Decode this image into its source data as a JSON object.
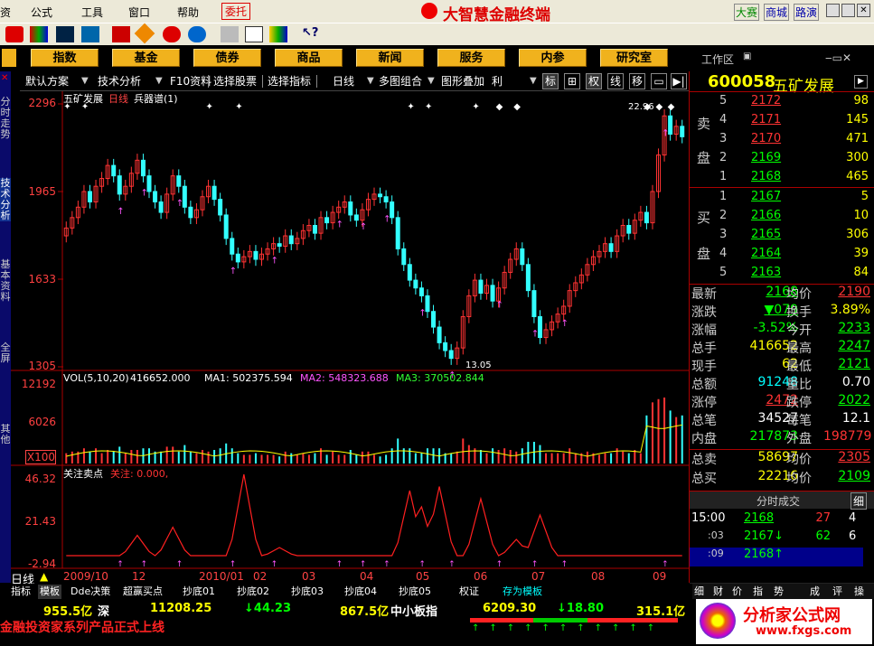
{
  "menu": {
    "items": [
      "资",
      "公式",
      "工具",
      "窗口",
      "帮助"
    ],
    "entrust": "委托",
    "app_title": "大智慧金融终端",
    "right_links": [
      "大赛",
      "商城",
      "路演"
    ]
  },
  "nav": {
    "buttons": [
      "指数",
      "基金",
      "债券",
      "商品",
      "新闻",
      "服务",
      "内参",
      "研究室"
    ],
    "workspace": "工作区"
  },
  "tabs": {
    "items": [
      "默认方案",
      "技术分析",
      "F10资料",
      "选择股票",
      "选择指标",
      "日线",
      "多图组合",
      "图形叠加",
      "利"
    ],
    "right_items": [
      "标",
      "权",
      "线",
      "移"
    ]
  },
  "left_rail": [
    "分时走势",
    "技术分析",
    "基本资料",
    "全屏",
    "其他"
  ],
  "stock": {
    "code": "600058",
    "name": "五矿发展"
  },
  "chart": {
    "title": "五矿发展",
    "period": "日线",
    "indicator": "兵器谱(1)",
    "price_ticks": [
      "2296",
      "1965",
      "1633",
      "1305"
    ],
    "high_label": "22.96",
    "low_label": "13.05",
    "vol_title": "VOL(5,10,20)",
    "vol_value": "416652.000",
    "ma1": "MA1: 502375.594",
    "ma2": "MA2: 548323.688",
    "ma3": "MA3: 370502.844",
    "vol_ticks": [
      "12192",
      "6026",
      "X100"
    ],
    "focus_title": "关注卖点",
    "focus_value": "关注: 0.000,",
    "focus_ticks": [
      "46.32",
      "21.43",
      "-2.94"
    ],
    "date_labels": [
      "2009/10",
      "12",
      "2010/01",
      "02",
      "03",
      "04",
      "05",
      "06",
      "07",
      "08",
      "09"
    ],
    "period_label": "日线"
  },
  "chart_data": {
    "type": "candlestick",
    "title": "五矿发展",
    "ylim": [
      13.05,
      22.96
    ],
    "closes": [
      18.2,
      18.6,
      19.0,
      19.6,
      19.2,
      19.8,
      20.1,
      20.6,
      20.2,
      19.5,
      19.8,
      20.3,
      20.8,
      20.2,
      19.6,
      19.2,
      18.8,
      19.5,
      20.2,
      19.8,
      19.0,
      18.6,
      18.9,
      19.4,
      19.8,
      19.3,
      18.7,
      17.8,
      17.2,
      16.9,
      17.1,
      17.3,
      17.0,
      17.2,
      17.4,
      17.6,
      17.5,
      17.9,
      17.6,
      17.8,
      18.1,
      18.3,
      18.0,
      18.6,
      18.4,
      18.8,
      19.0,
      19.2,
      18.7,
      18.5,
      18.9,
      19.3,
      19.5,
      19.4,
      19.2,
      18.6,
      17.4,
      16.8,
      16.2,
      15.9,
      15.6,
      15.0,
      14.4,
      13.8,
      13.5,
      13.2,
      13.6,
      14.8,
      15.6,
      16.2,
      15.7,
      16.0,
      15.4,
      15.9,
      16.5,
      17.0,
      17.4,
      16.8,
      15.8,
      14.8,
      14.0,
      14.3,
      14.6,
      14.9,
      15.2,
      15.8,
      16.1,
      16.4,
      16.8,
      17.1,
      17.3,
      17.6,
      17.3,
      17.9,
      18.3,
      18.0,
      18.5,
      18.8,
      18.4,
      19.6,
      21.0,
      22.5,
      21.8,
      22.1,
      21.7
    ],
    "volume_ticks": [
      12192,
      6026
    ],
    "focus_series_range": [
      -2.94,
      46.32
    ]
  },
  "orderbook": {
    "sell_label": [
      "卖",
      "盘"
    ],
    "buy_label": [
      "买",
      "盘"
    ],
    "sell": [
      {
        "lvl": "5",
        "price": "2172",
        "vol": "98"
      },
      {
        "lvl": "4",
        "price": "2171",
        "vol": "145"
      },
      {
        "lvl": "3",
        "price": "2170",
        "vol": "471"
      },
      {
        "lvl": "2",
        "price": "2169",
        "vol": "300"
      },
      {
        "lvl": "1",
        "price": "2168",
        "vol": "465"
      }
    ],
    "buy": [
      {
        "lvl": "1",
        "price": "2167",
        "vol": "5"
      },
      {
        "lvl": "2",
        "price": "2166",
        "vol": "10"
      },
      {
        "lvl": "3",
        "price": "2165",
        "vol": "306"
      },
      {
        "lvl": "4",
        "price": "2164",
        "vol": "39"
      },
      {
        "lvl": "5",
        "price": "2163",
        "vol": "84"
      }
    ]
  },
  "stats": [
    {
      "k1": "最新",
      "v1": "2168",
      "k2": "均价",
      "v2": "2190"
    },
    {
      "k1": "涨跌",
      "v1": "▼079",
      "k2": "换手",
      "v2": "3.89%"
    },
    {
      "k1": "涨幅",
      "v1": "-3.52%",
      "k2": "今开",
      "v2": "2233"
    },
    {
      "k1": "总手",
      "v1": "416652",
      "k2": "最高",
      "v2": "2247"
    },
    {
      "k1": "现手",
      "v1": "62",
      "k2": "最低",
      "v2": "2121"
    },
    {
      "k1": "总额",
      "v1": "91248",
      "k2": "量比",
      "v2": "0.70"
    },
    {
      "k1": "涨停",
      "v1": "2472",
      "k2": "跌停",
      "v2": "2022"
    },
    {
      "k1": "总笔",
      "v1": "34527",
      "k2": "每笔",
      "v2": "12.1"
    },
    {
      "k1": "内盘",
      "v1": "217873",
      "k2": "外盘",
      "v2": "198779"
    },
    {
      "k1": "总卖",
      "v1": "58697",
      "k2": "均价",
      "v2": "2305"
    },
    {
      "k1": "总买",
      "v1": "22216",
      "k2": "均价",
      "v2": "2109"
    }
  ],
  "ticks_panel": {
    "header": "分时成交",
    "tab": "细",
    "rows": [
      {
        "time": "15:00",
        "price": "2168",
        "vol": "27",
        "n": "4"
      },
      {
        "time": ":03",
        "price": "2167↓",
        "vol": "62",
        "n": "6"
      },
      {
        "time": ":09",
        "price": "2168↑",
        "vol": "",
        "n": ""
      }
    ]
  },
  "right_tabs": [
    "细",
    "财",
    "价",
    "指",
    "势",
    "成",
    "评",
    "操"
  ],
  "bottom": {
    "tabs": [
      "指标",
      "模板",
      "Dde决策",
      "超赢买点",
      "抄底01",
      "抄底02",
      "抄底03",
      "抄底04",
      "抄底05",
      "权证",
      "存为模板"
    ],
    "ticker": [
      {
        "text": "955.5亿",
        "color": "#ffff00"
      },
      {
        "text": "深",
        "color": "#ffffff"
      },
      {
        "text": "11208.25",
        "color": "#ffff00"
      },
      {
        "text": "↓44.23",
        "color": "#00ff00"
      },
      {
        "text": "867.5亿",
        "color": "#ffff00"
      },
      {
        "text": "中小板指",
        "color": "#ffffff"
      },
      {
        "text": "6209.30",
        "color": "#ffff00"
      },
      {
        "text": "↓18.80",
        "color": "#00ff00"
      },
      {
        "text": "315.1亿",
        "color": "#ffff00"
      }
    ],
    "marquee": "金融投资家系列产品正式上线",
    "watermark": "分析家公式网",
    "watermark_url": "www.fxgs.com"
  }
}
